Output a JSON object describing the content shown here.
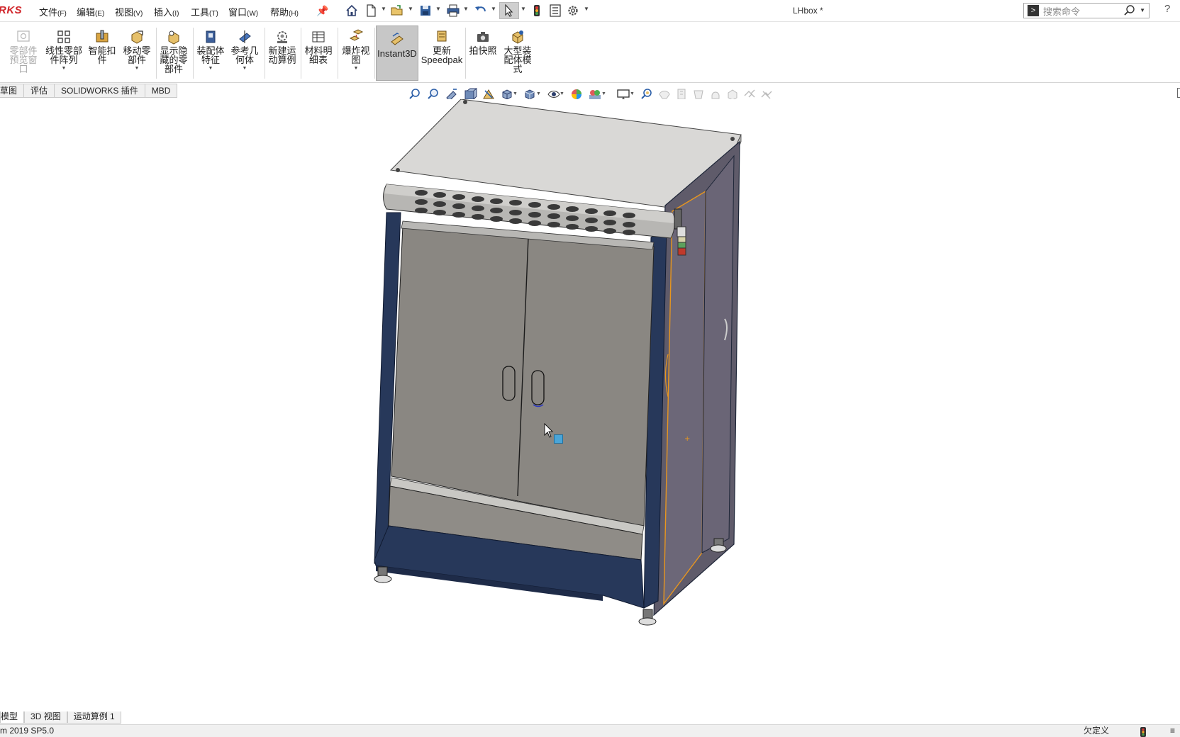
{
  "app": {
    "logo": "RKS",
    "document_title": "LHbox *",
    "version": "m 2019 SP5.0"
  },
  "menu": [
    {
      "label": "文件",
      "key": "(F)"
    },
    {
      "label": "编辑",
      "key": "(E)"
    },
    {
      "label": "视图",
      "key": "(V)"
    },
    {
      "label": "插入",
      "key": "(I)"
    },
    {
      "label": "工具",
      "key": "(T)"
    },
    {
      "label": "窗口",
      "key": "(W)"
    },
    {
      "label": "帮助",
      "key": "(H)"
    }
  ],
  "search": {
    "placeholder": "搜索命令"
  },
  "ribbon": [
    {
      "label": "零部件\n预览窗\n口",
      "icon": "component-preview-icon",
      "disabled": true
    },
    {
      "label": "线性零部\n件阵列",
      "icon": "linear-pattern-icon",
      "has_menu": true
    },
    {
      "label": "智能扣\n件",
      "icon": "smart-fasteners-icon"
    },
    {
      "label": "移动零\n部件",
      "icon": "move-component-icon",
      "has_menu": true
    },
    {
      "label": "显示隐\n藏的零\n部件",
      "icon": "show-hidden-icon"
    },
    {
      "label": "装配体\n特征",
      "icon": "assembly-features-icon",
      "has_menu": true
    },
    {
      "label": "参考几\n何体",
      "icon": "reference-geometry-icon",
      "has_menu": true
    },
    {
      "label": "新建运\n动算例",
      "icon": "motion-study-icon"
    },
    {
      "label": "材料明\n细表",
      "icon": "bom-icon"
    },
    {
      "label": "爆炸视\n图",
      "icon": "exploded-view-icon",
      "has_menu": true
    },
    {
      "label": "Instant3D",
      "icon": "instant3d-icon",
      "active": true
    },
    {
      "label": "更新\nSpeedpak",
      "icon": "speedpak-icon"
    },
    {
      "label": "拍快照",
      "icon": "snapshot-icon"
    },
    {
      "label": "大型装\n配体模\n式",
      "icon": "large-assembly-icon"
    }
  ],
  "command_tabs": [
    "草图",
    "评估",
    "SOLIDWORKS 插件",
    "MBD"
  ],
  "bottom_tabs": [
    "模型",
    "3D 视图",
    "运动算例 1"
  ],
  "status": {
    "state": "欠定义"
  },
  "colors": {
    "accent": "#2474c8",
    "logo": "#d1262b",
    "frame": "#2c3e5c",
    "door": "#8a8782",
    "highlight": "#e8961e"
  }
}
